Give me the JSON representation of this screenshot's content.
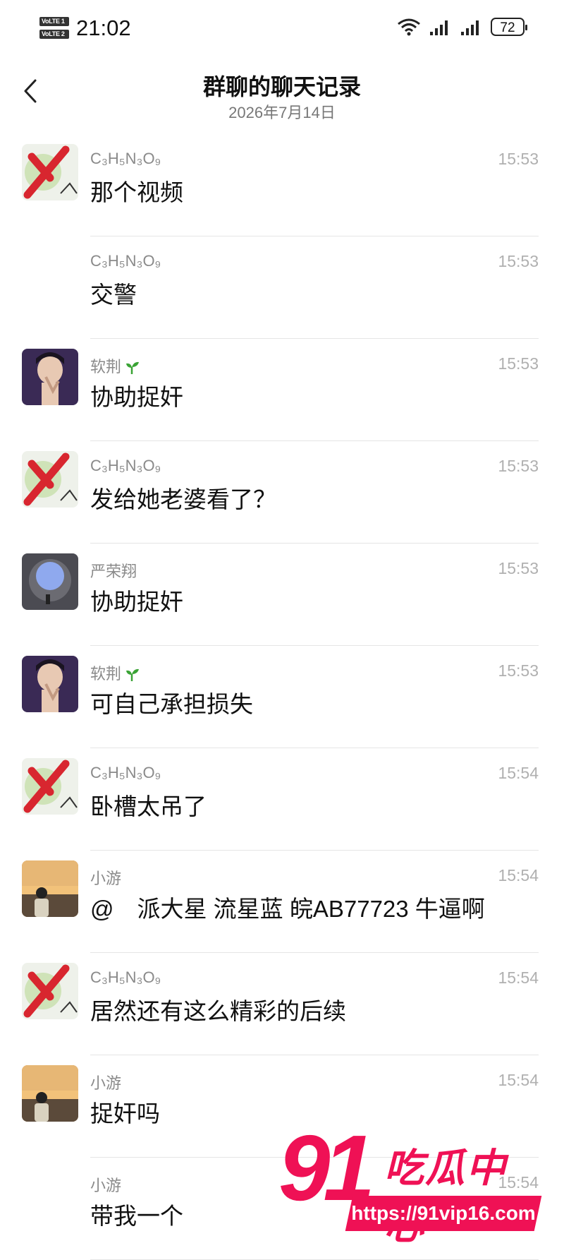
{
  "status_bar": {
    "time": "21:02",
    "sim1": "VoLTE 1",
    "sim2": "VoLTE 2",
    "battery": "72"
  },
  "header": {
    "title": "群聊的聊天记录",
    "date": "2026年7月14日",
    "back_icon": "chevron-left-icon"
  },
  "messages": [
    {
      "sender": "C₃H₅N₃O₉",
      "time": "15:53",
      "text": "那个视频",
      "avatar": "red-x"
    },
    {
      "sender": "C₃H₅N₃O₉",
      "time": "15:53",
      "text": "交警",
      "avatar": "none"
    },
    {
      "sender": "软荆",
      "time": "15:53",
      "text": "协助捉奸",
      "avatar": "person"
    },
    {
      "sender": "C₃H₅N₃O₉",
      "time": "15:53",
      "text": "发给她老婆看了？",
      "avatar": "red-x"
    },
    {
      "sender": "严荣翔",
      "time": "15:53",
      "text": "协助捉奸",
      "avatar": "dome"
    },
    {
      "sender": "软荆",
      "time": "15:53",
      "text": "可自己承担损失",
      "avatar": "person"
    },
    {
      "sender": "C₃H₅N₃O₉",
      "time": "15:54",
      "text": "卧槽太吊了",
      "avatar": "red-x"
    },
    {
      "sender": "小游",
      "time": "15:54",
      "text": "@　派大星 流星蓝  皖AB77723 牛逼啊",
      "avatar": "sunset"
    },
    {
      "sender": "C₃H₅N₃O₉",
      "time": "15:54",
      "text": "居然还有这么精彩的后续",
      "avatar": "red-x"
    },
    {
      "sender": "小游",
      "time": "15:54",
      "text": "捉奸吗",
      "avatar": "sunset"
    },
    {
      "sender": "小游",
      "time": "15:54",
      "text": "带我一个",
      "avatar": "none"
    }
  ],
  "watermark": {
    "number": "91",
    "name": "吃瓜中心",
    "url": "https://91vip16.com"
  },
  "colors": {
    "watermark": "#ef1155",
    "sprout": "#3aa335"
  }
}
